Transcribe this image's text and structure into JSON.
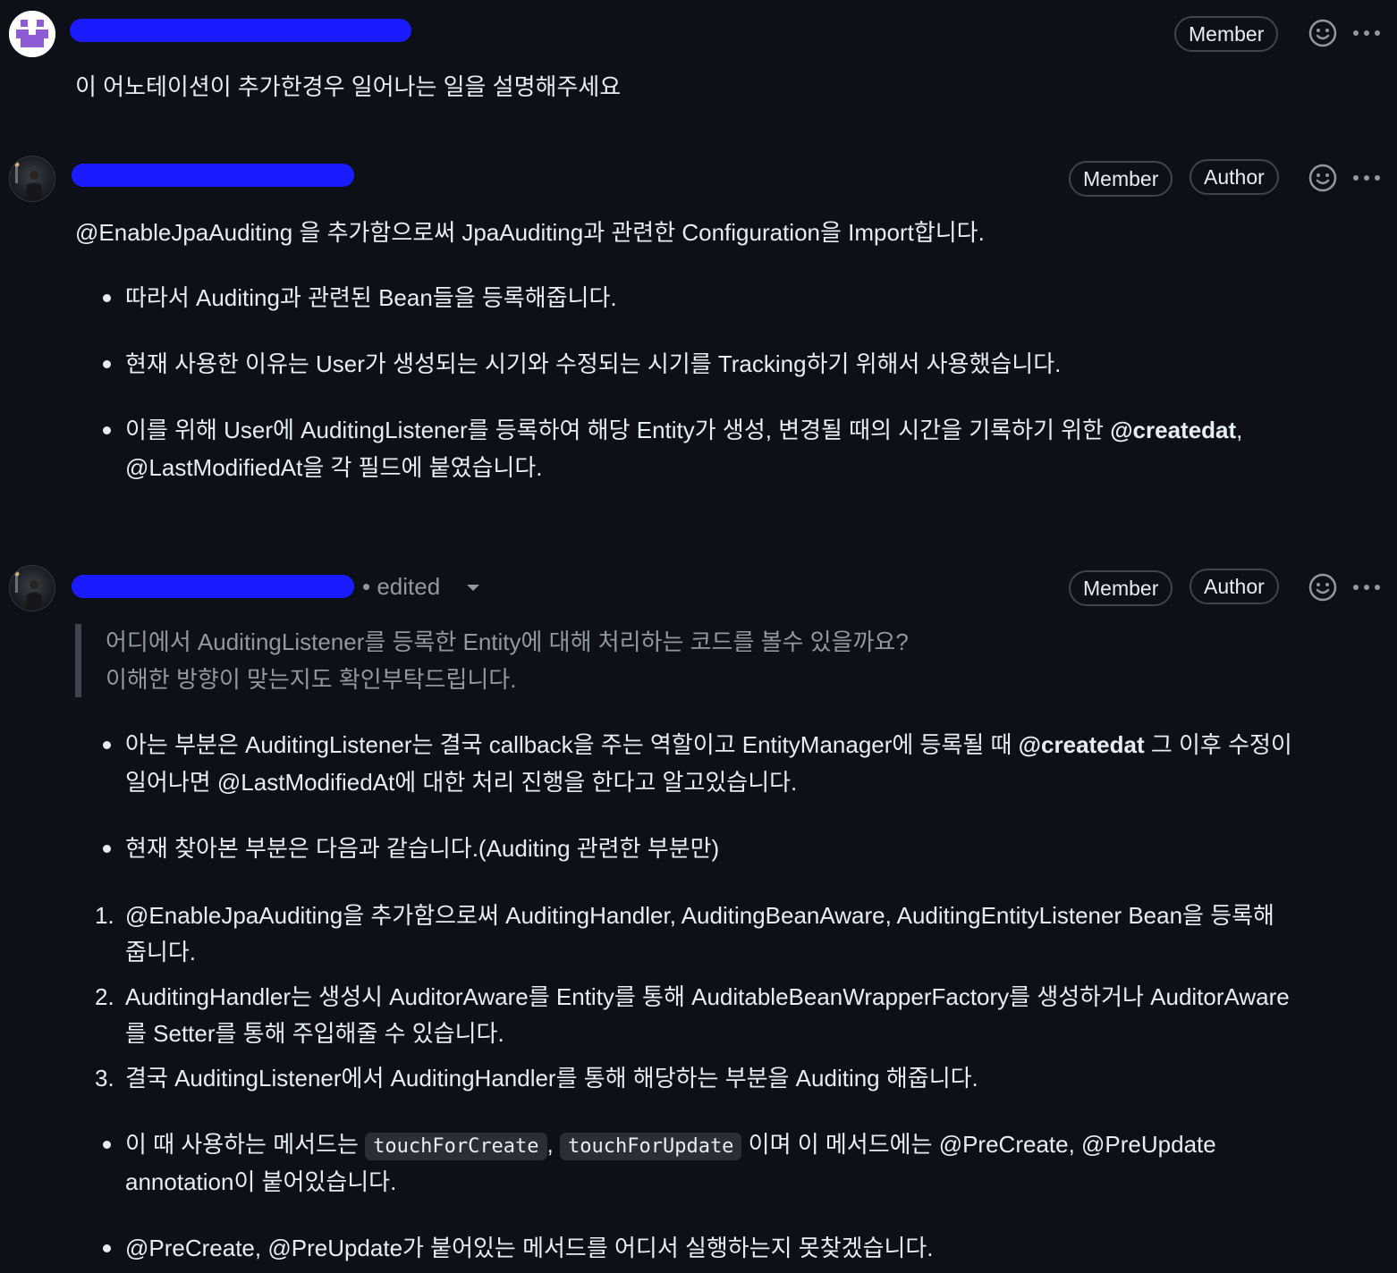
{
  "comments": [
    {
      "badges": [
        "Member"
      ],
      "body": {
        "question": "이 어노테이션이 추가한경우 일어나는 일을 설명해주세요"
      }
    },
    {
      "badges": [
        "Member",
        "Author"
      ],
      "body": {
        "intro_pre": "@EnableJpaAuditing 을 추가함으로써 JpaAuditing과 관련한 Configuration을 Import합니다.",
        "b1": "따라서 Auditing과 관련된 Bean들을 등록해줍니다.",
        "b2": "현재 사용한 이유는 User가 생성되는 시기와 수정되는 시기를 Tracking하기 위해서 사용했습니다.",
        "b3_pre": "이를 위해 User에 AuditingListener를 등록하여 해당 Entity가 생성, 변경될 때의 시간을 기록하기 위한 ",
        "b3_bold": "@createdat",
        "b3_post": ",",
        "b3_line2": "@LastModifiedAt을 각 필드에 붙였습니다."
      }
    },
    {
      "badges": [
        "Member",
        "Author"
      ],
      "edited_label": "• edited",
      "body": {
        "quote1": "어디에서 AuditingListener를 등록한 Entity에 대해 처리하는 코드를 볼수 있을까요?",
        "quote2": "이해한 방향이 맞는지도 확인부탁드립니다.",
        "b1_pre": "아는 부분은 AuditingListener는 결국 callback을 주는 역할이고 EntityManager에 등록될 때 ",
        "b1_bold": "@createdat",
        "b1_post": " 그 이후 수정이",
        "b1_line2": "일어나면 @LastModifiedAt에 대한 처리 진행을 한다고 알고있습니다.",
        "b2": "현재 찾아본 부분은 다음과 같습니다.(Auditing 관련한 부분만)",
        "n1_line1": "@EnableJpaAuditing을 추가함으로써 AuditingHandler, AuditingBeanAware, AuditingEntityListener Bean을 등록해",
        "n1_line2": "줍니다.",
        "n2_line1": "AuditingHandler는 생성시 AuditorAware를 Entity를 통해 AuditableBeanWrapperFactory를 생성하거나 AuditorAware",
        "n2_line2": "를 Setter를 통해 주입해줄 수 있습니다.",
        "n3": "결국 AuditingListener에서 AuditingHandler를 통해 해당하는 부분을 Auditing 해줍니다.",
        "b3_pre": "이 때 사용하는 메서드는 ",
        "b3_code1": "touchForCreate",
        "b3_sep": ", ",
        "b3_code2": "touchForUpdate",
        "b3_post": " 이며 이 메서드에는 @PreCreate, @PreUpdate",
        "b3_line2": "annotation이 붙어있습니다.",
        "b4": "@PreCreate, @PreUpdate가 붙어있는 메서드를 어디서 실행하는지 못찾겠습니다."
      }
    }
  ],
  "numbers": [
    "1.",
    "2.",
    "3."
  ],
  "icons": [
    "smiley-icon",
    "kebab-icon",
    "caret-down-icon"
  ],
  "colors": {
    "background": "#0d1117",
    "redaction": "#1b1bff",
    "muted": "#9198a1",
    "border": "#3d444d"
  }
}
